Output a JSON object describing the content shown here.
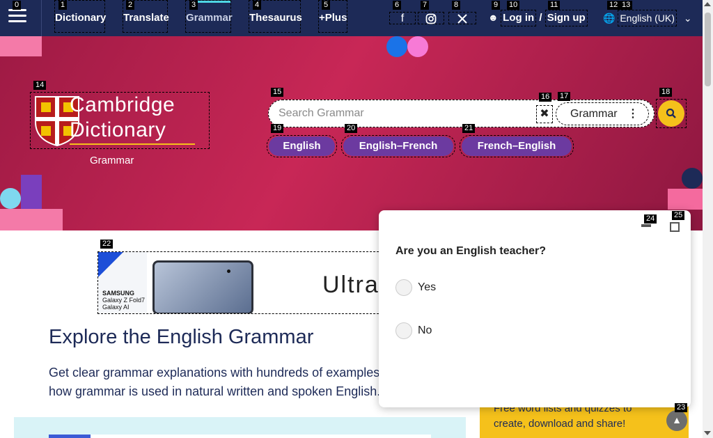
{
  "nav": {
    "links": [
      {
        "label": "Dictionary",
        "tag": "1"
      },
      {
        "label": "Translate",
        "tag": "2"
      },
      {
        "label": "Grammar",
        "tag": "3"
      },
      {
        "label": "Thesaurus",
        "tag": "4"
      },
      {
        "label": "+Plus",
        "tag": "5"
      }
    ],
    "menu_tag": "0",
    "social_tags": [
      "6",
      "7",
      "8"
    ],
    "login_tag": "9",
    "login_label": "Log in",
    "login_tag2": "10",
    "separator": "/",
    "signup_label": "Sign up",
    "signup_tag": "11",
    "language_label": "English (UK)",
    "language_tag": "12",
    "language_tag2": "13"
  },
  "hero": {
    "logo_tag": "14",
    "logo_line1": "Cambridge",
    "logo_line2": "Dictionary",
    "logo_sub": "Grammar",
    "search_tag": "15",
    "search_placeholder": "Search Grammar",
    "clear_tag": "16",
    "dict_tag": "17",
    "dict_label": "Grammar",
    "search_btn_tag": "18",
    "pills": [
      {
        "label": "English",
        "tag": "19"
      },
      {
        "label": "English–French",
        "tag": "20"
      },
      {
        "label": "French–English",
        "tag": "21"
      }
    ]
  },
  "ad": {
    "tag": "22",
    "brand_line1": "SAMSUNG",
    "brand_line2": "Galaxy Z Fold7",
    "brand_line3": "Galaxy AI",
    "title": "Ultra"
  },
  "content": {
    "heading": "Explore the English Grammar",
    "lead": "Get clear grammar explanations with hundreds of examples showing how grammar is used in natural written and spoken English.",
    "promo_text": "Free word lists and quizzes to create, download and share!"
  },
  "survey": {
    "question": "Are you an English teacher?",
    "options": [
      "Yes",
      "No"
    ],
    "minimize_tag": "24",
    "expand_tag": "25"
  },
  "back_to_top_tag": "23",
  "colors": {
    "nav_bg": "#1d2a57",
    "hero_bg": "#c82756",
    "accent_yellow": "#f5c11b",
    "pill_purple": "#6c3aa0"
  }
}
